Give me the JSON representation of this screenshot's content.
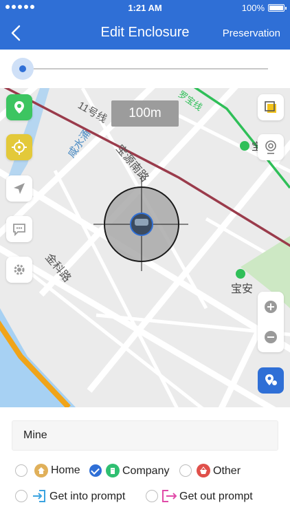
{
  "status_bar": {
    "time": "1:21 AM",
    "battery": "100%"
  },
  "nav": {
    "title": "Edit Enclosure",
    "right_action": "Preservation"
  },
  "slider": {
    "value_fraction": 0.0
  },
  "map": {
    "scale_label": "100m",
    "labels": {
      "line11": "11号线",
      "baoyuan_road": "宝源南路",
      "xiansui": "咸水涌",
      "jinke_road": "金科路",
      "baoan": "宝安",
      "line1": "1号线",
      "luobao_line": "罗宝线",
      "bao": "宝"
    },
    "left_tools": [
      "map-pin-icon",
      "crosshair-icon",
      "paper-plane-icon",
      "chat-bubble-icon",
      "gear-icon"
    ],
    "right_tools": [
      "layers-icon",
      "camera-icon"
    ],
    "zoom": [
      "plus-icon",
      "minus-icon"
    ]
  },
  "form": {
    "name_value": "Mine",
    "categories": [
      {
        "label": "Home",
        "icon": "home-icon",
        "color": "#e0b05a",
        "checked": false
      },
      {
        "label": "Company",
        "icon": "building-icon",
        "color": "#2fbf71",
        "checked": true
      },
      {
        "label": "Other",
        "icon": "basket-icon",
        "color": "#e0504a",
        "checked": false
      }
    ],
    "prompts": [
      {
        "label": "Get into prompt",
        "icon": "enter-icon",
        "color": "#3aa3e0",
        "checked": false
      },
      {
        "label": "Get out prompt",
        "icon": "exit-icon",
        "color": "#e04aa8",
        "checked": false
      }
    ]
  },
  "colors": {
    "accent": "#2f6fd6",
    "metro_red": "#9a3b4b",
    "metro_green": "#2fbf58",
    "water": "#a7d1f3",
    "highway": "#f0a419"
  }
}
